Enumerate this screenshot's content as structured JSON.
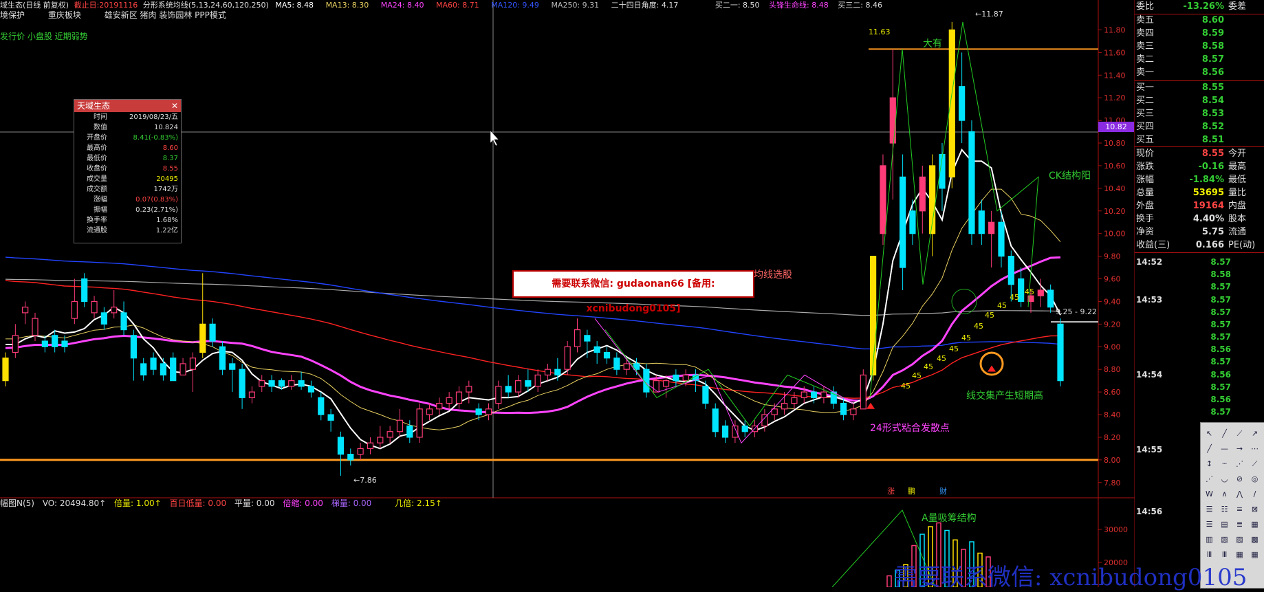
{
  "top_bar": {
    "stock_title": "域生态(日线 前复权)",
    "cal_date": "截止日:20191116",
    "indicator": "分形系统均线(5,13,24,60,120,250)",
    "ma5": "MA5: 8.48",
    "ma13": "MA13: 8.30",
    "ma24": "MA24: 8.40",
    "ma60": "MA60: 8.71",
    "ma120": "MA120: 9.49",
    "ma250": "MA250: 9.31",
    "angle": "二十四日角度: 4.17",
    "buy1": "买二一: 8.50",
    "life_line": "头锋生命线: 8.48",
    "buy2": "买三二: 8.46"
  },
  "concept_bar": {
    "items": [
      "境保护",
      "重庆板块",
      "雄安新区 猪肉 装饰园林 PPP模式"
    ]
  },
  "tag_line": "发行价 小盘股 近期弱势",
  "info_box": {
    "title": "天域生态",
    "close": "✕",
    "rows": [
      {
        "k": "时间",
        "v": "2019/08/23/五",
        "c": "#ddd"
      },
      {
        "k": "数值",
        "v": "10.824",
        "c": "#ddd"
      },
      {
        "k": "开盘价",
        "v": "8.41(-0.83%)",
        "c": "#3c3"
      },
      {
        "k": "最高价",
        "v": "8.60",
        "c": "#f44"
      },
      {
        "k": "最低价",
        "v": "8.37",
        "c": "#3c3"
      },
      {
        "k": "收盘价",
        "v": "8.55",
        "c": "#f44"
      },
      {
        "k": "成交量",
        "v": "20495",
        "c": "#ee0"
      },
      {
        "k": "成交额",
        "v": "1742万",
        "c": "#ddd"
      },
      {
        "k": "涨幅",
        "v": "0.07(0.83%)",
        "c": "#f44"
      },
      {
        "k": "振幅",
        "v": "0.23(2.71%)",
        "c": "#ddd"
      },
      {
        "k": "换手率",
        "v": "1.68%",
        "c": "#ddd"
      },
      {
        "k": "流通股",
        "v": "1.22亿",
        "c": "#ddd"
      }
    ]
  },
  "annotations": {
    "price_high": "11.87",
    "price_low": "7.86",
    "line_1163": "11.63",
    "dayou": "大有",
    "ck": "CK结构阳",
    "jx_xg": "均线选股",
    "cross_short_high": "线交集产生短期高",
    "form24": "24形式粘合发散点",
    "range_label": "9.25 - 9.22",
    "cursor_price": "10.82",
    "n45": "45",
    "vol_title": "A量吸筹结构",
    "markers": [
      "涨",
      "鹏",
      "财"
    ]
  },
  "banner": {
    "text": "需要联系微信: gudaonan66 [备用: xcnibudong0105]"
  },
  "price_axis": [
    "11.80",
    "11.60",
    "11.40",
    "11.20",
    "11.00",
    "10.80",
    "10.60",
    "10.40",
    "10.20",
    "10.00",
    "9.80",
    "9.60",
    "9.40",
    "9.20",
    "9.00",
    "8.80",
    "8.60",
    "8.40",
    "8.20",
    "8.00",
    "7.80"
  ],
  "vol_axis": [
    "30000",
    "20000"
  ],
  "vol_bar": {
    "name": "幅图N(5)",
    "vo": "VO: 20494.80↑",
    "beiliang": "倍量: 1.00↑",
    "bairi": "百日低量: 0.00",
    "pingliang": "平量: 0.00",
    "beisuo": "倍缩: 0.00",
    "tiliang": "梯量: 0.00",
    "jidi": "几倍: 2.15↑"
  },
  "quote_panel": {
    "weibi": {
      "k": "委比",
      "v": "-13.26%",
      "k2": "委差"
    },
    "asks": [
      {
        "k": "卖五",
        "v": "8.60"
      },
      {
        "k": "卖四",
        "v": "8.59"
      },
      {
        "k": "卖三",
        "v": "8.58"
      },
      {
        "k": "卖二",
        "v": "8.57"
      },
      {
        "k": "卖一",
        "v": "8.56"
      }
    ],
    "bids": [
      {
        "k": "买一",
        "v": "8.55"
      },
      {
        "k": "买二",
        "v": "8.54"
      },
      {
        "k": "买三",
        "v": "8.53"
      },
      {
        "k": "买四",
        "v": "8.52"
      },
      {
        "k": "买五",
        "v": "8.51"
      }
    ],
    "stats": [
      {
        "k": "现价",
        "v": "8.55",
        "k2": "今开",
        "c": "#f44"
      },
      {
        "k": "涨跌",
        "v": "-0.16",
        "k2": "最高",
        "c": "#3c3"
      },
      {
        "k": "涨幅",
        "v": "-1.84%",
        "k2": "最低",
        "c": "#3c3"
      },
      {
        "k": "总量",
        "v": "53695",
        "k2": "量比",
        "c": "#ee0"
      },
      {
        "k": "外盘",
        "v": "19164",
        "k2": "内盘",
        "c": "#f44"
      },
      {
        "k": "换手",
        "v": "4.40%",
        "k2": "股本",
        "c": "#ddd"
      },
      {
        "k": "净资",
        "v": "5.75",
        "k2": "流通",
        "c": "#ddd"
      },
      {
        "k": "收益(三)",
        "v": "0.166",
        "k2": "PE(动)",
        "c": "#ddd"
      }
    ],
    "ticks": [
      {
        "time": "14:52",
        "prices": [
          "8.57",
          "8.58",
          "8.57"
        ]
      },
      {
        "time": "14:53",
        "prices": [
          "8.57",
          "8.57",
          "8.57",
          "8.57",
          "8.56",
          "8.57"
        ]
      },
      {
        "time": "14:54",
        "prices": [
          "8.56",
          "8.57",
          "8.56",
          "8.57"
        ]
      },
      {
        "time": "14:55",
        "prices": []
      },
      {
        "time": "14:56",
        "prices": []
      }
    ]
  },
  "watermark": "需要联系微信: xcnibudong0105",
  "colors": {
    "up": "#ff3c78",
    "down": "#00e5ff",
    "ma5": "#ffffff",
    "ma13": "#e8d060",
    "ma24": "#ff44ff",
    "ma60": "#ff2222",
    "ma120": "#2244ff",
    "ma250": "#aaaaaa",
    "orange": "#ff9a20"
  },
  "chart_data": {
    "type": "candlestick",
    "y_range": [
      7.75,
      11.9
    ],
    "candles": [
      [
        8.9,
        8.7,
        8.95,
        8.65
      ],
      [
        8.95,
        9.1,
        9.2,
        8.9
      ],
      [
        9.3,
        9.35,
        9.4,
        9.2
      ],
      [
        9.1,
        9.25,
        9.3,
        9.05
      ],
      [
        9.05,
        9.0,
        9.1,
        8.95
      ],
      [
        9.1,
        9.0,
        9.15,
        8.95
      ],
      [
        9.05,
        9.0,
        9.1,
        8.95
      ],
      [
        9.25,
        9.4,
        9.6,
        9.2
      ],
      [
        9.6,
        9.4,
        9.65,
        9.35
      ],
      [
        9.3,
        9.4,
        9.45,
        9.25
      ],
      [
        9.3,
        9.2,
        9.35,
        9.15
      ],
      [
        9.3,
        9.35,
        9.5,
        9.25
      ],
      [
        9.3,
        9.15,
        9.4,
        9.1
      ],
      [
        9.1,
        8.9,
        9.15,
        8.7
      ],
      [
        8.85,
        8.75,
        8.9,
        8.7
      ],
      [
        8.9,
        8.8,
        8.95,
        8.75
      ],
      [
        8.85,
        8.75,
        8.9,
        8.7
      ],
      [
        8.9,
        8.7,
        8.95,
        8.7
      ],
      [
        8.75,
        8.85,
        8.9,
        8.8
      ],
      [
        8.8,
        8.9,
        8.95,
        8.6
      ],
      [
        8.95,
        9.2,
        9.65,
        8.9
      ],
      [
        9.2,
        9.05,
        9.25,
        9.0
      ],
      [
        9.0,
        8.8,
        9.05,
        8.75
      ],
      [
        8.85,
        8.8,
        8.9,
        8.6
      ],
      [
        8.8,
        8.55,
        8.85,
        8.45
      ],
      [
        8.55,
        8.6,
        8.65,
        8.5
      ],
      [
        8.65,
        8.7,
        8.75,
        8.6
      ],
      [
        8.7,
        8.65,
        8.75,
        8.6
      ],
      [
        8.7,
        8.65,
        8.72,
        8.62
      ],
      [
        8.65,
        8.7,
        8.75,
        8.62
      ],
      [
        8.7,
        8.65,
        8.78,
        8.62
      ],
      [
        8.65,
        8.6,
        8.7,
        8.55
      ],
      [
        8.55,
        8.4,
        8.6,
        8.35
      ],
      [
        8.4,
        8.35,
        8.45,
        8.25
      ],
      [
        8.2,
        8.05,
        8.25,
        7.86
      ],
      [
        8.05,
        8.0,
        8.1,
        7.95
      ],
      [
        8.05,
        8.1,
        8.15,
        8.0
      ],
      [
        8.1,
        8.15,
        8.2,
        8.05
      ],
      [
        8.15,
        8.2,
        8.3,
        8.1
      ],
      [
        8.2,
        8.25,
        8.3,
        8.15
      ],
      [
        8.25,
        8.35,
        8.45,
        8.2
      ],
      [
        8.3,
        8.2,
        8.35,
        8.15
      ],
      [
        8.2,
        8.45,
        8.5,
        8.15
      ],
      [
        8.4,
        8.45,
        8.5,
        8.35
      ],
      [
        8.45,
        8.5,
        8.55,
        8.4
      ],
      [
        8.5,
        8.55,
        8.6,
        8.45
      ],
      [
        8.5,
        8.6,
        8.65,
        8.45
      ],
      [
        8.6,
        8.65,
        8.7,
        8.5
      ],
      [
        8.45,
        8.4,
        8.5,
        8.35
      ],
      [
        8.4,
        8.45,
        8.5,
        8.35
      ],
      [
        8.5,
        8.65,
        8.7,
        8.45
      ],
      [
        8.65,
        8.6,
        8.75,
        8.55
      ],
      [
        8.6,
        8.7,
        8.75,
        8.55
      ],
      [
        8.7,
        8.65,
        8.8,
        8.6
      ],
      [
        8.65,
        8.75,
        8.8,
        8.6
      ],
      [
        8.75,
        8.8,
        8.85,
        8.7
      ],
      [
        8.8,
        8.75,
        8.9,
        8.7
      ],
      [
        8.8,
        9.0,
        9.05,
        8.75
      ],
      [
        9.0,
        9.15,
        9.25,
        8.95
      ],
      [
        9.1,
        9.05,
        9.15,
        8.9
      ],
      [
        9.0,
        8.95,
        9.05,
        8.85
      ],
      [
        8.95,
        8.9,
        9.0,
        8.85
      ],
      [
        8.9,
        8.8,
        8.95,
        8.75
      ],
      [
        8.8,
        8.85,
        8.9,
        8.75
      ],
      [
        8.85,
        8.8,
        8.9,
        8.75
      ],
      [
        8.8,
        8.6,
        8.85,
        8.55
      ],
      [
        8.6,
        8.7,
        8.75,
        8.6
      ],
      [
        8.65,
        8.7,
        8.75,
        8.55
      ],
      [
        8.75,
        8.7,
        8.8,
        8.65
      ],
      [
        8.7,
        8.75,
        8.8,
        8.65
      ],
      [
        8.75,
        8.7,
        8.8,
        8.6
      ],
      [
        8.65,
        8.5,
        8.7,
        8.45
      ],
      [
        8.45,
        8.25,
        8.5,
        8.2
      ],
      [
        8.3,
        8.2,
        8.35,
        8.15
      ],
      [
        8.2,
        8.3,
        8.35,
        8.15
      ],
      [
        8.3,
        8.25,
        8.35,
        8.2
      ],
      [
        8.25,
        8.3,
        8.35,
        8.2
      ],
      [
        8.3,
        8.4,
        8.45,
        8.25
      ],
      [
        8.4,
        8.45,
        8.5,
        8.35
      ],
      [
        8.45,
        8.5,
        8.6,
        8.4
      ],
      [
        8.5,
        8.55,
        8.6,
        8.45
      ],
      [
        8.55,
        8.6,
        8.65,
        8.5
      ],
      [
        8.6,
        8.55,
        8.65,
        8.5
      ],
      [
        8.55,
        8.6,
        8.65,
        8.5
      ],
      [
        8.6,
        8.5,
        8.65,
        8.45
      ],
      [
        8.5,
        8.4,
        8.55,
        8.35
      ],
      [
        8.4,
        8.45,
        8.5,
        8.35
      ],
      [
        8.45,
        8.75,
        8.8,
        8.45
      ],
      [
        8.75,
        9.8,
        9.8,
        8.7
      ],
      [
        10.0,
        10.6,
        10.7,
        9.9
      ],
      [
        10.8,
        11.2,
        11.63,
        10.3
      ],
      [
        10.5,
        9.7,
        10.7,
        9.5
      ],
      [
        10.2,
        10.0,
        10.3,
        9.9
      ],
      [
        10.2,
        10.5,
        10.6,
        10.0
      ],
      [
        10.6,
        10.0,
        10.7,
        9.8
      ],
      [
        10.7,
        10.4,
        10.8,
        10.2
      ],
      [
        10.5,
        11.8,
        11.87,
        10.4
      ],
      [
        11.3,
        11.0,
        11.6,
        10.8
      ],
      [
        10.9,
        10.0,
        11.0,
        9.9
      ],
      [
        10.2,
        10.0,
        10.3,
        9.9
      ],
      [
        10.0,
        10.1,
        10.2,
        9.7
      ],
      [
        10.1,
        9.8,
        10.2,
        9.7
      ],
      [
        9.8,
        9.55,
        9.85,
        9.4
      ],
      [
        9.6,
        9.4,
        9.7,
        9.35
      ],
      [
        9.4,
        9.45,
        9.5,
        9.3
      ],
      [
        9.45,
        9.5,
        9.6,
        9.35
      ],
      [
        9.5,
        9.35,
        9.55,
        9.3
      ],
      [
        9.2,
        8.7,
        9.25,
        8.65
      ]
    ],
    "volumes": [
      6000,
      9000,
      12000,
      22000,
      28000,
      32000,
      34000,
      30000,
      25000,
      20000,
      24000,
      18000,
      16000
    ]
  }
}
